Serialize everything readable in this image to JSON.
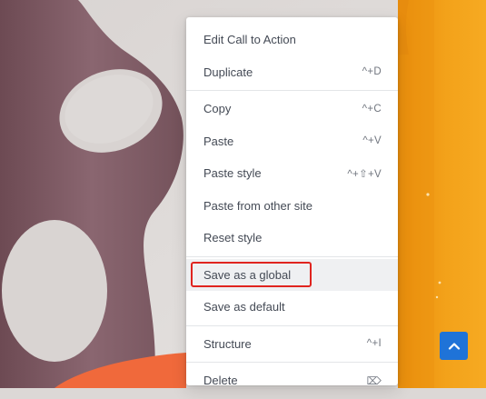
{
  "context_menu": {
    "groups": [
      {
        "items": [
          {
            "label": "Edit Call to Action",
            "shortcut": ""
          },
          {
            "label": "Duplicate",
            "shortcut": "^+D"
          }
        ]
      },
      {
        "items": [
          {
            "label": "Copy",
            "shortcut": "^+C"
          },
          {
            "label": "Paste",
            "shortcut": "^+V"
          },
          {
            "label": "Paste style",
            "shortcut": "^+⇧+V"
          },
          {
            "label": "Paste from other site",
            "shortcut": ""
          },
          {
            "label": "Reset style",
            "shortcut": ""
          }
        ]
      },
      {
        "items": [
          {
            "label": "Save as a global",
            "shortcut": ""
          },
          {
            "label": "Save as default",
            "shortcut": ""
          }
        ]
      },
      {
        "items": [
          {
            "label": "Structure",
            "shortcut": "^+I"
          }
        ]
      },
      {
        "items": [
          {
            "label": "Delete",
            "shortcut": "⌦"
          }
        ]
      }
    ]
  },
  "colors": {
    "highlight_box": "#e0241f",
    "scroll_button": "#1f73d8",
    "vase_purple": "#7e5a63",
    "vase_orange": "#ef9a12",
    "base_orange": "#f2683a"
  },
  "icons": {
    "scroll_top": "chevron-up-icon",
    "delete": "delete-key-icon"
  }
}
